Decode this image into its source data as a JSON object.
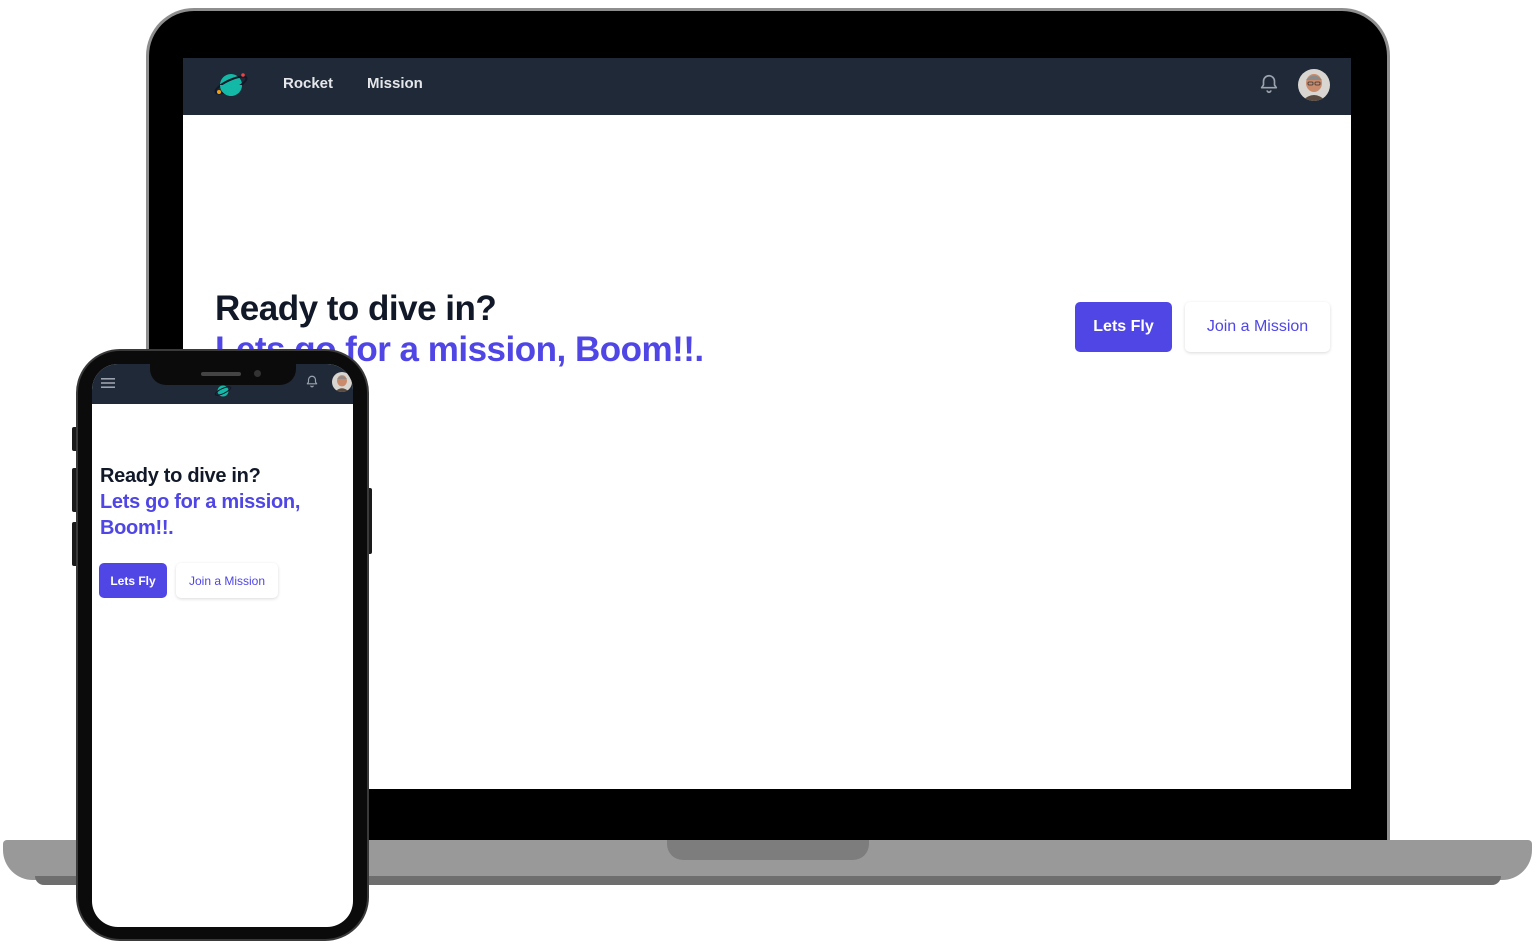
{
  "desktop": {
    "nav": {
      "logo_icon": "planet-icon",
      "links": [
        {
          "label": "Rocket"
        },
        {
          "label": "Mission"
        }
      ],
      "notification_icon": "bell-icon",
      "avatar_icon": "user-avatar"
    },
    "hero": {
      "title": "Ready to dive in?",
      "subtitle": "Lets go for a mission, Boom!!."
    },
    "buttons": {
      "primary": "Lets Fly",
      "secondary": "Join a Mission"
    }
  },
  "mobile": {
    "nav": {
      "menu_icon": "hamburger-menu-icon",
      "logo_icon": "planet-icon",
      "notification_icon": "bell-icon",
      "avatar_icon": "user-avatar"
    },
    "hero": {
      "title": "Ready to dive in?",
      "subtitle": "Lets go for a mission, Boom!!."
    },
    "buttons": {
      "primary": "Lets Fly",
      "secondary": "Join a Mission"
    }
  },
  "colors": {
    "nav_bg": "#1f2937",
    "accent": "#4f46e5",
    "heading": "#111827",
    "logo_teal": "#14b8a6"
  }
}
